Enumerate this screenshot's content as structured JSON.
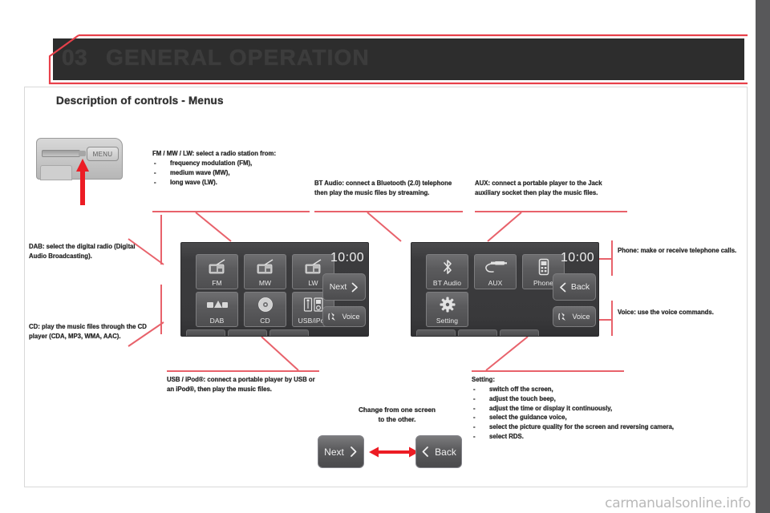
{
  "header": {
    "chapter_number": "03",
    "title": "GENERAL OPERATION",
    "subtitle": "Description of controls - Menus",
    "accent_color": "#e8404a",
    "band_color": "#2d2d2d"
  },
  "hardware": {
    "menu_button_label": "MENU",
    "menu_button_name": "menu-hard-key"
  },
  "callouts": {
    "fm_mw_lw": {
      "lead": "FM / MW / LW: select a radio station from:",
      "items": [
        "frequency modulation (FM),",
        "medium wave (MW),",
        "long wave (LW)."
      ]
    },
    "dab": {
      "lead": "DAB: select the digital radio (Digital Audio Broadcasting)."
    },
    "cd": {
      "lead": "CD: play the music files through the CD player (CDA, MP3, WMA, AAC)."
    },
    "usb_ipod": {
      "lead": "USB / iPod®: connect a portable player by USB or an iPod®, then play the music files."
    },
    "bt_audio": {
      "lead": "BT Audio: connect a Bluetooth (2.0) telephone then play the music files by streaming."
    },
    "aux": {
      "lead": "AUX: connect a portable player to the Jack auxiliary socket then play the music files."
    },
    "phone": {
      "lead": "Phone: make or receive telephone calls."
    },
    "voice": {
      "lead": "Voice: use the voice commands."
    },
    "setting": {
      "lead": "Setting:",
      "items": [
        "switch off the screen,",
        "adjust the touch beep,",
        "adjust the time or display it continuously,",
        "select the guidance voice,",
        "select the picture quality for the screen and reversing camera,",
        "select RDS."
      ]
    }
  },
  "screen_left": {
    "clock": "10:00",
    "tiles": [
      {
        "label": "FM",
        "icon": "radio-fm-icon"
      },
      {
        "label": "MW",
        "icon": "radio-mw-icon"
      },
      {
        "label": "LW",
        "icon": "radio-lw-icon"
      },
      {
        "label": "DAB",
        "icon": "dab-icon"
      },
      {
        "label": "CD",
        "icon": "cd-disc-icon"
      },
      {
        "label": "USB/iPod",
        "icon": "usb-ipod-icon"
      }
    ],
    "next_label": "Next",
    "next_icon": "chevron-right-icon",
    "voice_label": "Voice",
    "voice_icon": "voice-wave-icon"
  },
  "screen_right": {
    "clock": "10:00",
    "tiles": [
      {
        "label": "BT Audio",
        "icon": "bluetooth-icon"
      },
      {
        "label": "AUX",
        "icon": "jack-plug-icon"
      },
      {
        "label": "Phone",
        "icon": "mobile-phone-icon"
      },
      {
        "label": "Setting",
        "icon": "gear-icon"
      }
    ],
    "back_label": "Back",
    "back_icon": "chevron-left-icon",
    "voice_label": "Voice",
    "voice_icon": "voice-wave-icon"
  },
  "switch_demo": {
    "caption_line1": "Change from one screen",
    "caption_line2": "to the other.",
    "next_label": "Next",
    "back_label": "Back",
    "arrow_icon": "double-arrow-icon",
    "arrow_color": "#ec1c24"
  },
  "footer": {
    "watermark": "carmanualsonline",
    "watermark_suffix": ".info"
  }
}
